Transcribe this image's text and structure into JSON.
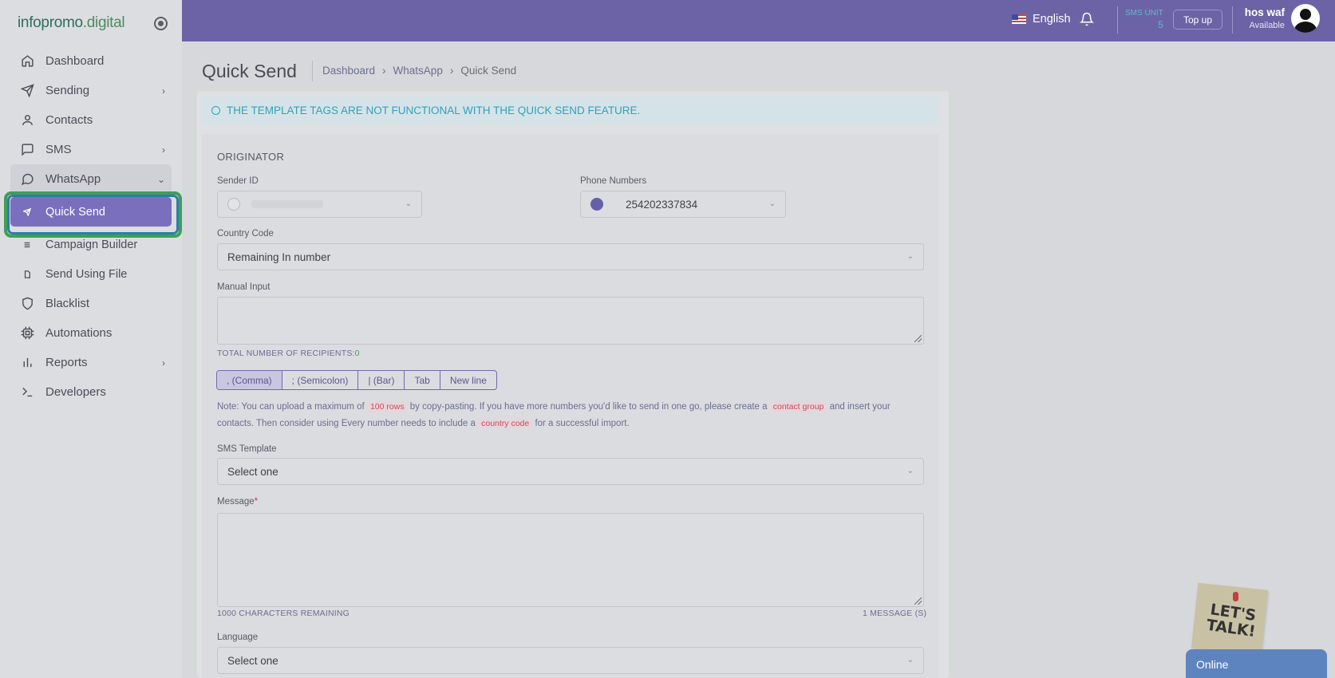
{
  "brand": {
    "name_a": "infopromo",
    "name_b": ".digital"
  },
  "sidebar": {
    "items": [
      {
        "label": "Dashboard"
      },
      {
        "label": "Sending"
      },
      {
        "label": "Contacts"
      },
      {
        "label": "SMS"
      },
      {
        "label": "WhatsApp"
      },
      {
        "label": "Quick Send"
      },
      {
        "label": "Campaign Builder"
      },
      {
        "label": "Send Using File"
      },
      {
        "label": "Blacklist"
      },
      {
        "label": "Automations"
      },
      {
        "label": "Reports"
      },
      {
        "label": "Developers"
      }
    ]
  },
  "topbar": {
    "language": "English",
    "sms_unit_label": "SMS UNIT",
    "sms_unit_value": "5",
    "topup_label": "Top up",
    "user_name": "hos waf",
    "user_status": "Available"
  },
  "page": {
    "title": "Quick Send",
    "breadcrumb": [
      "Dashboard",
      "WhatsApp",
      "Quick Send"
    ]
  },
  "alert": "THE TEMPLATE TAGS ARE NOT FUNCTIONAL WITH THE QUICK SEND FEATURE.",
  "form": {
    "section": "ORIGINATOR",
    "sender_id_label": "Sender ID",
    "sender_id_value": "",
    "phone_numbers_label": "Phone Numbers",
    "phone_numbers_value": "254202337834",
    "country_code_label": "Country Code",
    "country_code_value": "Remaining In number",
    "manual_input_label": "Manual Input",
    "recipients_label": "TOTAL NUMBER OF RECIPIENTS:",
    "recipients_value": "0",
    "separators": [
      ", (Comma)",
      "; (Semicolon)",
      "| (Bar)",
      "Tab",
      "New line"
    ],
    "note_1": "Note: You can upload a maximum of",
    "note_tag_1": "100 rows",
    "note_2": "by copy-pasting. If you have more numbers you'd like to send in one go, please create a",
    "note_tag_2": "contact group",
    "note_3": "and insert your contacts. Then consider using Every number needs to include a",
    "note_tag_3": "country code",
    "note_4": "for a successful import.",
    "sms_template_label": "SMS Template",
    "sms_template_value": "Select one",
    "message_label": "Message",
    "message_required": "*",
    "chars_remaining": "1000 CHARACTERS REMAINING",
    "message_count": "1 MESSAGE (S)",
    "language_label": "Language",
    "language_value": "Select one"
  },
  "chat": {
    "sticky_text": "LET'S TALK!",
    "status": "Online"
  },
  "colors": {
    "topbar": "#6c63a6",
    "active_nav": "#7a6fbd",
    "alert_text": "#2fa2b9"
  }
}
